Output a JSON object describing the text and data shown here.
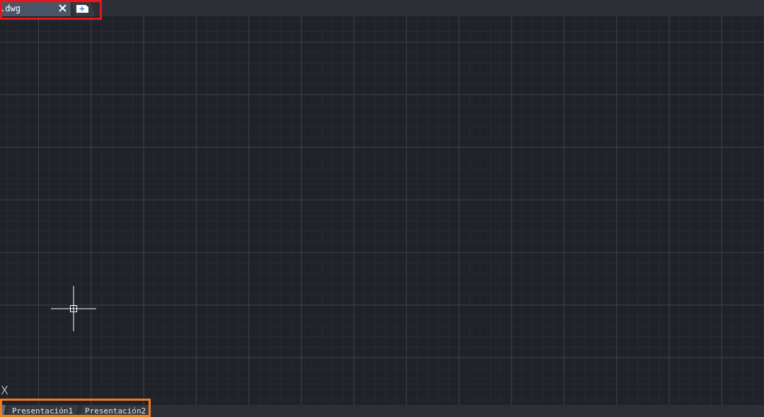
{
  "file_tabs": [
    {
      "label": ".dwg",
      "selected": true
    }
  ],
  "canvas": {
    "ucs_label": "X"
  },
  "layout_tabs": [
    {
      "label": "Presentación1",
      "selected": false
    },
    {
      "label": "Presentación2",
      "selected": false
    }
  ],
  "highlights": [
    {
      "kind": "top",
      "color": "#e8151b"
    },
    {
      "kind": "bottom",
      "color": "#f47a20"
    }
  ]
}
